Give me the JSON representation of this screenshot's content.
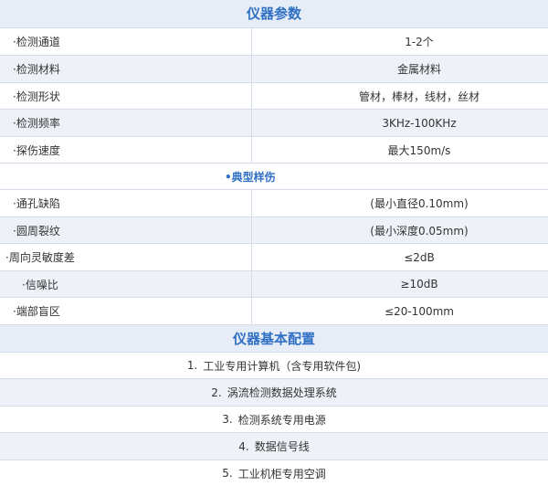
{
  "section1": {
    "title": "仪器参数",
    "rows": [
      {
        "key": "·检测通道",
        "value": "1-2个"
      },
      {
        "key": "·检测材料",
        "value": "金属材料"
      },
      {
        "key": "·检测形状",
        "value": "管材，棒材，线材，丝材"
      },
      {
        "key": "·检测频率",
        "value": "3KHz-100KHz"
      },
      {
        "key": "·探伤速度",
        "value": "最大150m/s"
      }
    ]
  },
  "section2": {
    "title": "•典型样伤",
    "rows": [
      {
        "key": "·通孔缺陷",
        "value": "(最小直径0.10mm)"
      },
      {
        "key": "·圆周裂纹",
        "value": "(最小深度0.05mm)"
      },
      {
        "key": "·周向灵敏度差",
        "value": "≤2dB"
      },
      {
        "key": "·信噪比",
        "value": "≥10dB"
      },
      {
        "key": "·端部盲区",
        "value": "≤20-100mm"
      }
    ]
  },
  "section3": {
    "title": "仪器基本配置",
    "items": [
      {
        "num": "1.",
        "text": "工业专用计算机（含专用软件包)"
      },
      {
        "num": "2.",
        "text": "涡流检测数据处理系统"
      },
      {
        "num": "3.",
        "text": "检测系统专用电源"
      },
      {
        "num": "4.",
        "text": "数据信号线"
      },
      {
        "num": "5.",
        "text": "工业机柜专用空调"
      }
    ]
  }
}
